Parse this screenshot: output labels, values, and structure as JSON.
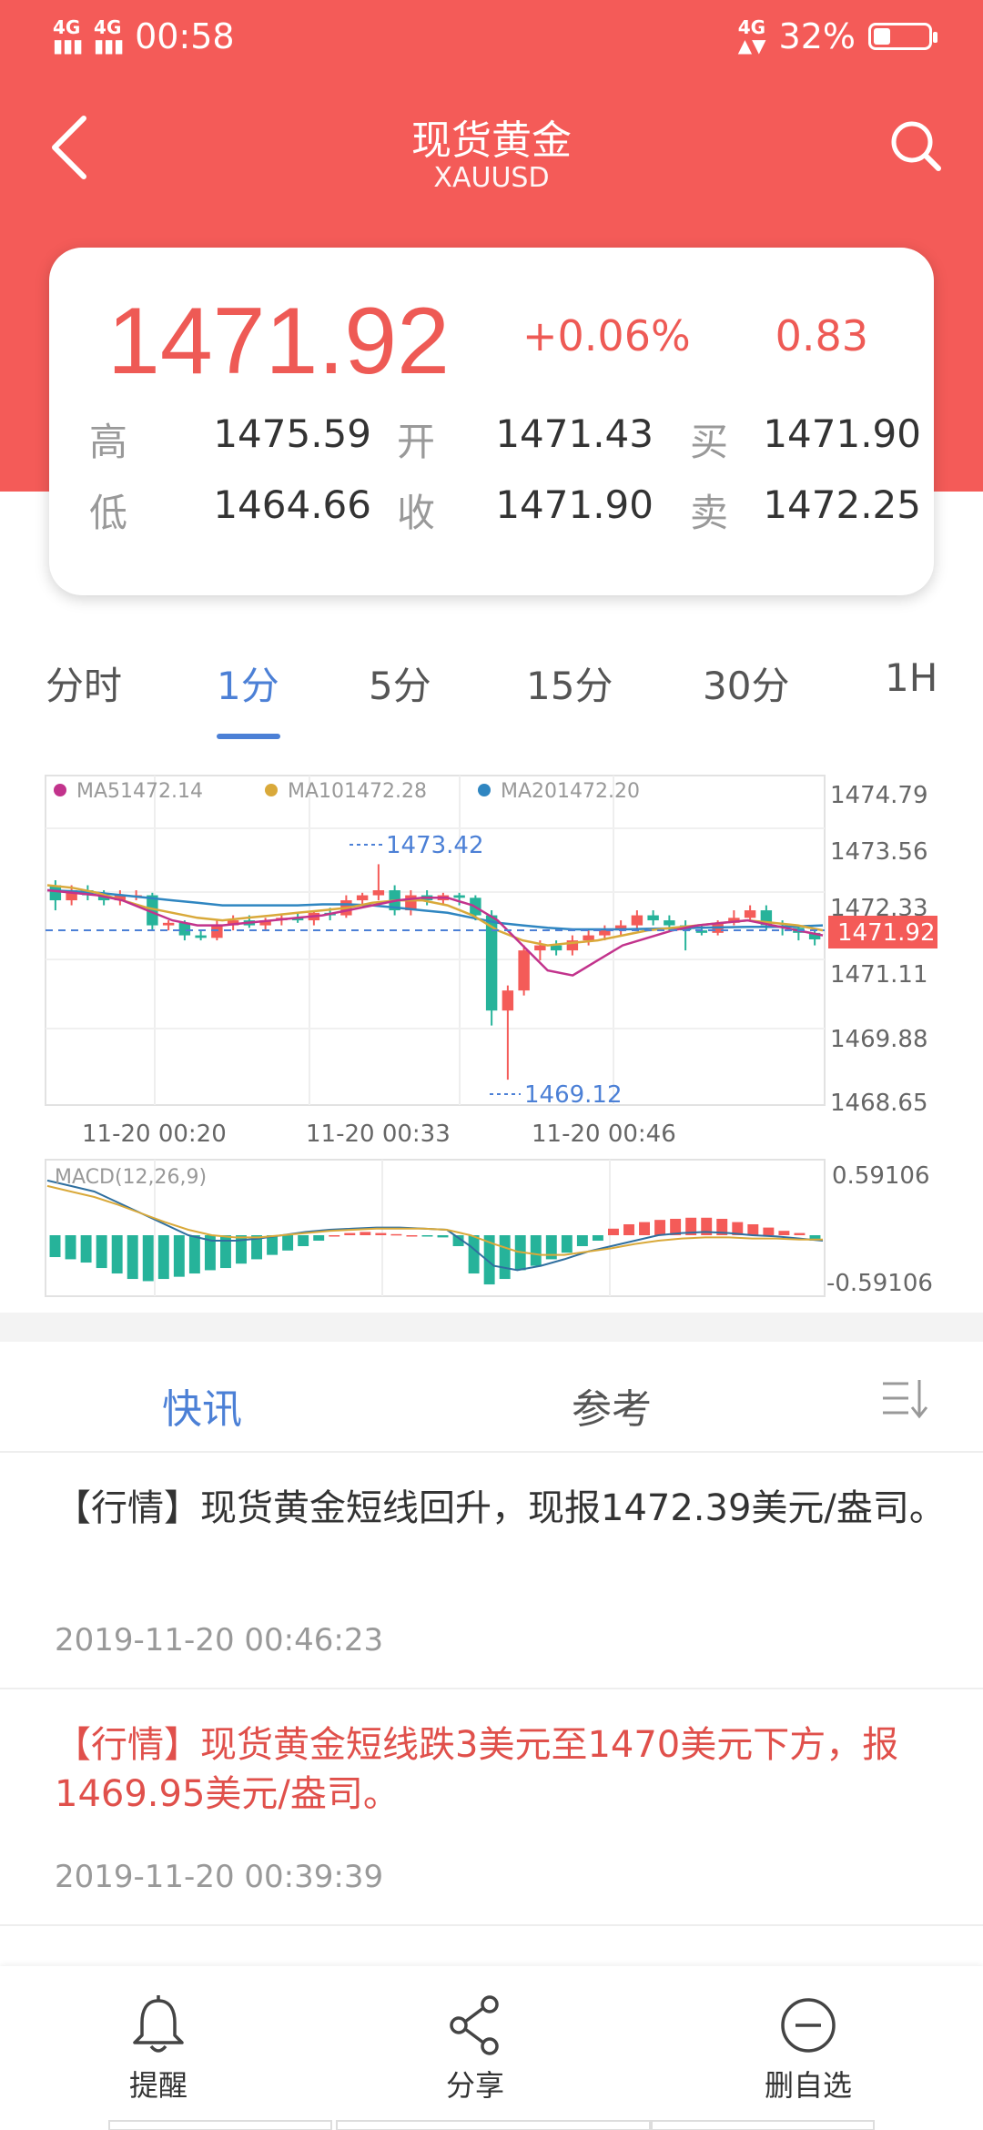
{
  "status": {
    "net1": "4G",
    "net2": "4G",
    "time": "00:58",
    "net3": "4G",
    "battery": "32%"
  },
  "header": {
    "title": "现货黄金",
    "subtitle": "XAUUSD"
  },
  "quote": {
    "price": "1471.92",
    "change_pct": "+0.06%",
    "change": "0.83",
    "high_label": "高",
    "high": "1475.59",
    "open_label": "开",
    "open": "1471.43",
    "bid_label": "买",
    "bid": "1471.90",
    "low_label": "低",
    "low": "1464.66",
    "close_label": "收",
    "close": "1471.90",
    "ask_label": "卖",
    "ask": "1472.25"
  },
  "tabs": [
    "分时",
    "1分",
    "5分",
    "15分",
    "30分",
    "1H"
  ],
  "chart": {
    "ma5_label": "MA5",
    "ma5": "1472.14",
    "ma10_label": "MA10",
    "ma10": "1472.28",
    "ma20_label": "MA20",
    "ma20": "1472.20",
    "y_ticks": [
      "1474.79",
      "1473.56",
      "1472.33",
      "1471.11",
      "1469.88",
      "1468.65"
    ],
    "current_price": "1471.92",
    "max_marker": "1473.42",
    "min_marker": "1469.12",
    "x_ticks": [
      "11-20 00:20",
      "11-20 00:33",
      "11-20 00:46"
    ],
    "macd_label": "MACD(12,26,9)",
    "macd_max": "0.59106",
    "macd_min": "-0.59106",
    "colors": {
      "up": "#f45b58",
      "down": "#26b39a",
      "ma5": "#c2338c",
      "ma10": "#d9a93a",
      "ma20": "#2f86c1"
    }
  },
  "chart_data": {
    "type": "candlestick",
    "ylim": [
      1468.65,
      1474.79
    ],
    "x_ticks": [
      "11-20 00:20",
      "11-20 00:33",
      "11-20 00:46"
    ],
    "ohlc": [
      [
        1473.0,
        1473.1,
        1472.5,
        1472.7
      ],
      [
        1472.7,
        1473.0,
        1472.6,
        1472.9
      ],
      [
        1472.9,
        1473.0,
        1472.7,
        1472.8
      ],
      [
        1472.8,
        1472.9,
        1472.6,
        1472.7
      ],
      [
        1472.7,
        1472.9,
        1472.6,
        1472.8
      ],
      [
        1472.8,
        1472.9,
        1472.7,
        1472.8
      ],
      [
        1472.8,
        1472.85,
        1472.1,
        1472.2
      ],
      [
        1472.2,
        1472.3,
        1472.1,
        1472.25
      ],
      [
        1472.25,
        1472.3,
        1471.9,
        1472.0
      ],
      [
        1472.0,
        1472.1,
        1471.9,
        1471.95
      ],
      [
        1471.95,
        1472.3,
        1471.9,
        1472.2
      ],
      [
        1472.2,
        1472.4,
        1472.1,
        1472.3
      ],
      [
        1472.3,
        1472.4,
        1472.15,
        1472.2
      ],
      [
        1472.2,
        1472.35,
        1472.1,
        1472.3
      ],
      [
        1472.3,
        1472.4,
        1472.2,
        1472.35
      ],
      [
        1472.35,
        1472.45,
        1472.25,
        1472.3
      ],
      [
        1472.3,
        1472.5,
        1472.2,
        1472.45
      ],
      [
        1472.45,
        1472.55,
        1472.3,
        1472.4
      ],
      [
        1472.4,
        1472.8,
        1472.35,
        1472.7
      ],
      [
        1472.7,
        1472.85,
        1472.6,
        1472.8
      ],
      [
        1472.8,
        1473.42,
        1472.7,
        1472.9
      ],
      [
        1472.9,
        1473.0,
        1472.4,
        1472.5
      ],
      [
        1472.5,
        1472.9,
        1472.4,
        1472.8
      ],
      [
        1472.8,
        1472.9,
        1472.6,
        1472.7
      ],
      [
        1472.7,
        1472.85,
        1472.6,
        1472.8
      ],
      [
        1472.8,
        1472.85,
        1472.6,
        1472.75
      ],
      [
        1472.75,
        1472.8,
        1472.3,
        1472.4
      ],
      [
        1472.4,
        1472.5,
        1470.2,
        1470.5
      ],
      [
        1470.5,
        1471.0,
        1469.12,
        1470.9
      ],
      [
        1470.9,
        1471.8,
        1470.8,
        1471.7
      ],
      [
        1471.7,
        1471.9,
        1471.5,
        1471.8
      ],
      [
        1471.8,
        1471.9,
        1471.6,
        1471.7
      ],
      [
        1471.7,
        1472.0,
        1471.6,
        1471.9
      ],
      [
        1471.9,
        1472.1,
        1471.8,
        1472.0
      ],
      [
        1472.0,
        1472.2,
        1471.9,
        1472.1
      ],
      [
        1472.1,
        1472.3,
        1472.0,
        1472.2
      ],
      [
        1472.2,
        1472.5,
        1472.1,
        1472.4
      ],
      [
        1472.4,
        1472.5,
        1472.2,
        1472.3
      ],
      [
        1472.3,
        1472.4,
        1472.1,
        1472.2
      ],
      [
        1472.2,
        1472.3,
        1471.7,
        1472.1
      ],
      [
        1472.1,
        1472.2,
        1472.0,
        1472.05
      ],
      [
        1472.05,
        1472.3,
        1472.0,
        1472.25
      ],
      [
        1472.25,
        1472.5,
        1472.2,
        1472.35
      ],
      [
        1472.35,
        1472.6,
        1472.3,
        1472.5
      ],
      [
        1472.5,
        1472.6,
        1472.1,
        1472.2
      ],
      [
        1472.2,
        1472.3,
        1472.0,
        1472.15
      ],
      [
        1472.15,
        1472.2,
        1471.9,
        1472.05
      ],
      [
        1472.05,
        1472.1,
        1471.8,
        1471.92
      ]
    ],
    "ma5": [
      1472.9,
      1472.85,
      1472.8,
      1472.7,
      1472.5,
      1472.3,
      1472.2,
      1472.2,
      1472.25,
      1472.3,
      1472.35,
      1472.4,
      1472.5,
      1472.6,
      1472.7,
      1472.75,
      1472.75,
      1472.6,
      1472.3,
      1471.8,
      1471.3,
      1471.2,
      1471.5,
      1471.8,
      1471.95,
      1472.1,
      1472.2,
      1472.25,
      1472.3,
      1472.2,
      1472.1,
      1472.0
    ],
    "ma10": [
      1473.0,
      1472.95,
      1472.85,
      1472.7,
      1472.55,
      1472.45,
      1472.35,
      1472.3,
      1472.35,
      1472.4,
      1472.45,
      1472.5,
      1472.55,
      1472.65,
      1472.7,
      1472.7,
      1472.6,
      1472.4,
      1472.1,
      1471.9,
      1471.8,
      1471.85,
      1471.9,
      1472.0,
      1472.1,
      1472.15,
      1472.2,
      1472.25,
      1472.3,
      1472.25,
      1472.2,
      1472.1
    ],
    "ma20": [
      1472.9,
      1472.88,
      1472.85,
      1472.8,
      1472.75,
      1472.7,
      1472.65,
      1472.6,
      1472.6,
      1472.6,
      1472.6,
      1472.62,
      1472.62,
      1472.6,
      1472.55,
      1472.5,
      1472.45,
      1472.35,
      1472.25,
      1472.2,
      1472.15,
      1472.12,
      1472.12,
      1472.12,
      1472.13,
      1472.14,
      1472.15,
      1472.16,
      1472.17,
      1472.17,
      1472.18,
      1472.2
    ],
    "macd_ylim": [
      -0.59106,
      0.59106
    ],
    "macd_hist": [
      -0.2,
      -0.22,
      -0.25,
      -0.3,
      -0.35,
      -0.4,
      -0.42,
      -0.4,
      -0.38,
      -0.35,
      -0.32,
      -0.3,
      -0.26,
      -0.22,
      -0.18,
      -0.14,
      -0.1,
      -0.05,
      0.0,
      0.02,
      0.03,
      0.02,
      0.01,
      0.0,
      -0.01,
      -0.02,
      -0.1,
      -0.35,
      -0.45,
      -0.4,
      -0.32,
      -0.28,
      -0.22,
      -0.16,
      -0.1,
      -0.05,
      0.06,
      0.1,
      0.12,
      0.14,
      0.15,
      0.16,
      0.16,
      0.15,
      0.12,
      0.1,
      0.07,
      0.04,
      0.02,
      -0.05
    ],
    "macd_dif": [
      0.5,
      0.45,
      0.4,
      0.3,
      0.2,
      0.1,
      0.0,
      -0.05,
      -0.05,
      -0.03,
      0.0,
      0.03,
      0.05,
      0.06,
      0.07,
      0.07,
      0.06,
      0.05,
      -0.1,
      -0.28,
      -0.32,
      -0.28,
      -0.22,
      -0.15,
      -0.1,
      -0.05,
      0.0,
      0.02,
      0.03,
      0.02,
      0.0,
      -0.01,
      -0.03,
      -0.05
    ],
    "macd_dea": [
      0.45,
      0.4,
      0.35,
      0.28,
      0.2,
      0.12,
      0.05,
      0.0,
      -0.02,
      -0.02,
      0.0,
      0.02,
      0.04,
      0.05,
      0.06,
      0.06,
      0.06,
      0.05,
      0.0,
      -0.08,
      -0.15,
      -0.18,
      -0.18,
      -0.15,
      -0.12,
      -0.08,
      -0.05,
      -0.03,
      -0.02,
      -0.02,
      -0.03,
      -0.03,
      -0.04,
      -0.04
    ]
  },
  "news_tabs": {
    "tab1": "快讯",
    "tab2": "参考"
  },
  "news": [
    {
      "text": "【行情】现货黄金短线回升，现报1472.39美元/盎司。",
      "time": "2019-11-20 00:46:23",
      "color": "#333333"
    },
    {
      "text": "【行情】现货黄金短线跌3美元至1470美元下方，报1469.95美元/盎司。",
      "time": "2019-11-20 00:39:39",
      "color": "#e0504b"
    }
  ],
  "bottom": {
    "remind": "提醒",
    "share": "分享",
    "remove": "删自选"
  }
}
